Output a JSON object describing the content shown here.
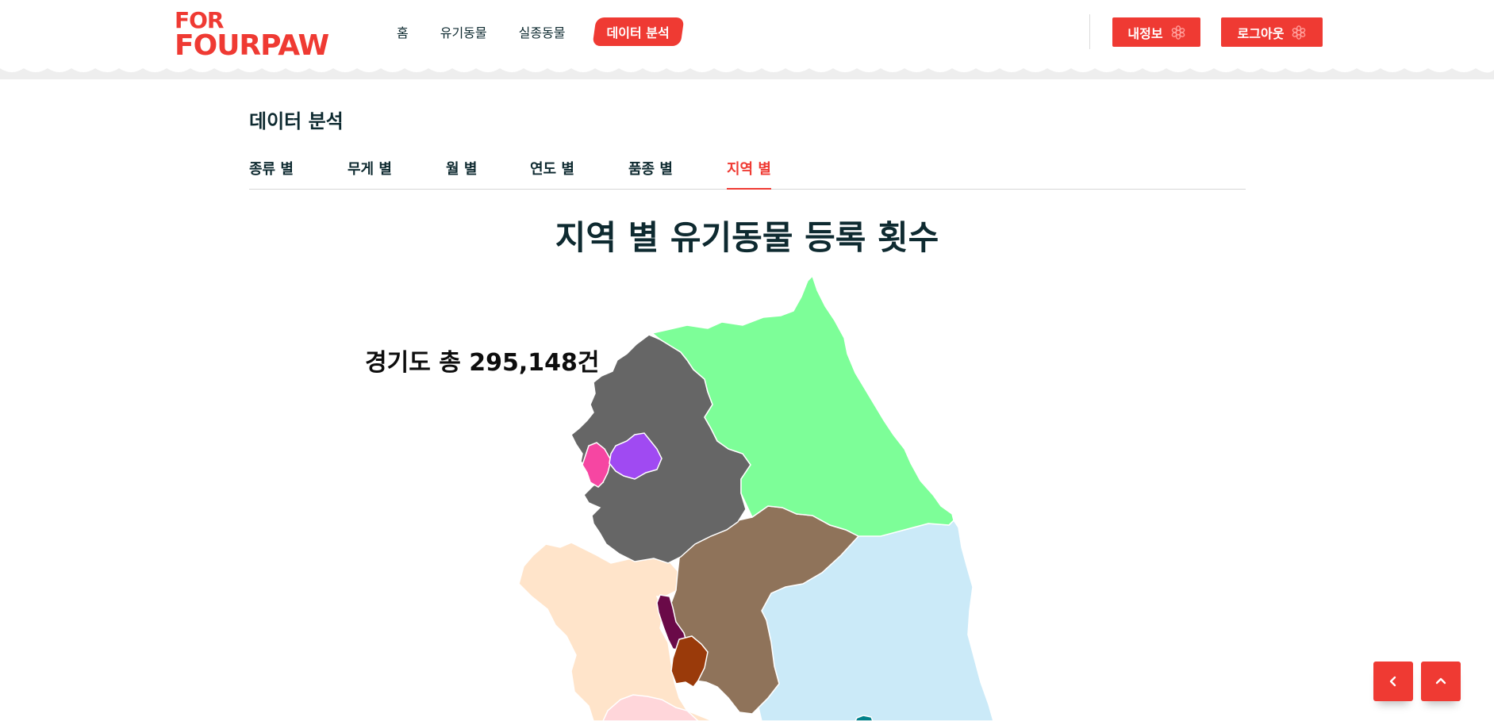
{
  "header": {
    "logo_line1": "FOR",
    "logo_line2": "FOURPAW",
    "nav": [
      "홈",
      "유기동물",
      "실종동물",
      "데이터 분석"
    ],
    "active_nav": "데이터 분석",
    "my_info_label": "내정보",
    "logout_label": "로그아웃",
    "button_icon": "paw-flower-icon"
  },
  "page": {
    "title": "데이터 분석",
    "tabs": [
      "종류 별",
      "무게 별",
      "월 별",
      "연도 별",
      "품종 별",
      "지역 별"
    ],
    "active_tab": "지역 별"
  },
  "map": {
    "title": "지역 별 유기동물 등록 횟수",
    "hover_label": "경기도 총 295,148건",
    "regions": [
      {
        "name": "경기도",
        "color": "#666666"
      },
      {
        "name": "강원도",
        "color": "#7dfe98"
      },
      {
        "name": "서울특별시",
        "color": "#a04af2"
      },
      {
        "name": "인천광역시",
        "color": "#f646a2"
      },
      {
        "name": "충청북도",
        "color": "#8f735a"
      },
      {
        "name": "충청남도",
        "color": "#ffe4ca"
      },
      {
        "name": "경상북도",
        "color": "#cbeaf8"
      },
      {
        "name": "세종특별자치시",
        "color": "#6a0a48"
      },
      {
        "name": "대전광역시",
        "color": "#9a3a0a"
      }
    ]
  },
  "floating": {
    "back_icon": "chevron-left-icon",
    "top_icon": "chevron-up-icon"
  },
  "colors": {
    "accent": "#ef3a33",
    "text_dark": "#0e2a30"
  }
}
